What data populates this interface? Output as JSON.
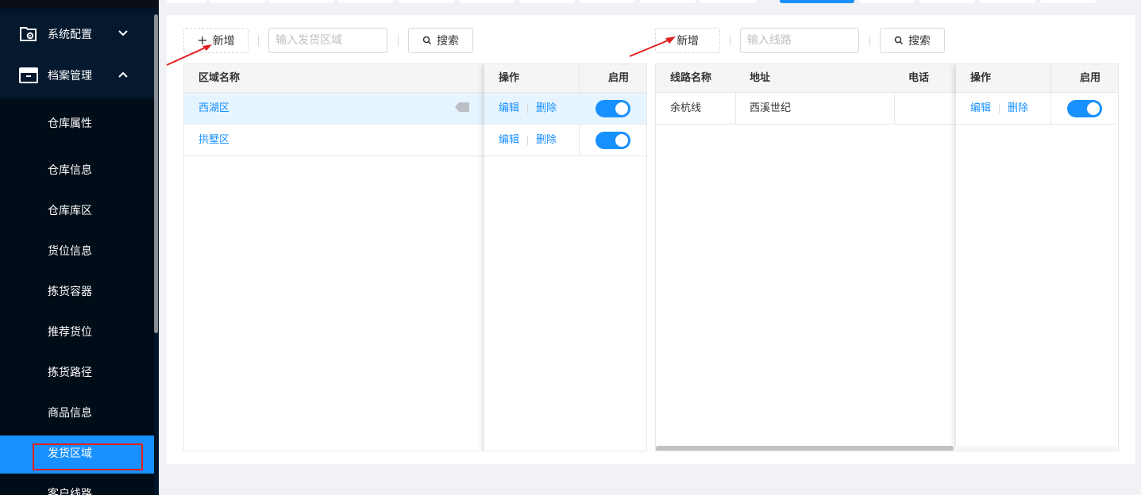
{
  "sidebar": {
    "groups": [
      {
        "label": "系统配置",
        "icon": "folder-gear-icon",
        "chevron": "chevron-down-icon"
      },
      {
        "label": "档案管理",
        "icon": "archive-box-icon",
        "chevron": "chevron-up-icon"
      }
    ],
    "items": [
      {
        "label": "仓库属性"
      },
      {
        "label": "仓库信息"
      },
      {
        "label": "仓库库区"
      },
      {
        "label": "货位信息"
      },
      {
        "label": "拣货容器"
      },
      {
        "label": "推荐货位"
      },
      {
        "label": "拣货路径"
      },
      {
        "label": "商品信息"
      },
      {
        "label": "发货区域",
        "active": true
      },
      {
        "label": "客户线路"
      }
    ]
  },
  "left": {
    "add_label": "新增",
    "search_placeholder": "输入发货区域",
    "search_label": "搜索",
    "columns": {
      "name": "区域名称",
      "ops": "操作",
      "enable": "启用"
    },
    "rows": [
      {
        "name": "西湖区",
        "edit": "编辑",
        "delete": "删除",
        "enabled": true
      },
      {
        "name": "拱墅区",
        "edit": "编辑",
        "delete": "删除",
        "enabled": true
      }
    ]
  },
  "right": {
    "add_label": "新增",
    "search_placeholder": "输入线路",
    "search_label": "搜索",
    "columns": {
      "name": "线路名称",
      "address": "地址",
      "phone": "电话",
      "ops": "操作",
      "enable": "启用"
    },
    "rows": [
      {
        "name": "余杭线",
        "address": "西溪世纪",
        "phone": "",
        "edit": "编辑",
        "delete": "删除",
        "enabled": true
      }
    ]
  },
  "colors": {
    "accent": "#1890ff",
    "sidebar": "#001529",
    "annotation": "#e02020"
  }
}
